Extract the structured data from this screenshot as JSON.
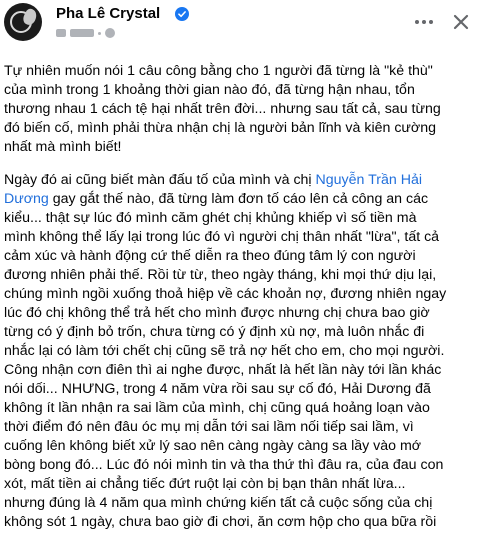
{
  "post": {
    "author": "Pha Lê Crystal",
    "paragraph1": "Tự nhiên muốn nói 1 câu công bằng cho 1 người đã từng là \"kẻ thù\"\ncủa mình trong 1 khoảng thời gian nào đó, đã từng hận nhau, tổn\nthương nhau 1 cách tệ hại nhất trên đời... nhưng sau tất cả, sau từng\nđó biến cố, mình phải thừa nhận chị là người bản lĩnh và kiên cường\nnhất mà mình biết!",
    "p2_before": "Ngày đó ai cũng biết màn đấu tố của mình và chị ",
    "p2_link": "Nguyễn Trần Hải\nDương",
    "p2_after": " gay gắt thế nào, đã từng làm đơn tố cáo lên cả công an các\nkiểu... thật sự lúc đó mình căm ghét chị khủng khiếp vì số tiền mà\nmình không thể lấy lại trong lúc đó vì người chị thân nhất \"lừa\", tất cả\ncảm xúc và hành động cứ thế diễn ra theo đúng tâm lý con người\nđương nhiên phải thế. Rồi từ từ, theo ngày tháng, khi mọi thứ dịu lại,\nchúng mình ngồi xuống thoả hiệp về các khoản nợ, đương nhiên ngay\nlúc đó chị không thể trả hết cho mình được nhưng chị chưa bao giờ\ntừng có ý định bỏ trốn, chưa từng có ý định xù nợ, mà luôn nhắc đi\nnhắc lại có làm tới chết chị cũng sẽ trả nợ hết cho em, cho mọi người.\nCông nhận cơn điên thì ai nghe được, nhất là hết lần này tới lần khác\nnói dối... NHƯNG, trong 4 năm vừa rồi sau sự cố đó, Hải Dương đã\nkhông ít lần nhận ra sai lầm của mình, chị cũng quá hoảng loạn vào\nthời điểm đó nên đâu óc mụ mị dẫn tới sai lầm nối tiếp sai lầm, vì\ncuống lên không biết xử lý sao nên càng ngày càng sa lầy vào mớ\nbòng bong đó... Lúc đó nói mình tin và tha thứ thì đâu ra, của đau con\nxót, mất tiền ai chẳng tiếc đứt ruột lại còn bị bạn thân nhất lừa...\nnhưng đúng là 4 năm qua mình chứng kiến tất cả cuộc sống của chị\nkhông sót 1 ngày, chưa bao giờ đi chơi, ăn cơm hộp cho qua bữa rồi"
  },
  "icons": {
    "verified": "verified-badge-icon",
    "more": "more-options-icon",
    "close": "close-icon"
  },
  "colors": {
    "link": "#216fdb",
    "verified": "#1877f2",
    "icon": "#65676b"
  }
}
